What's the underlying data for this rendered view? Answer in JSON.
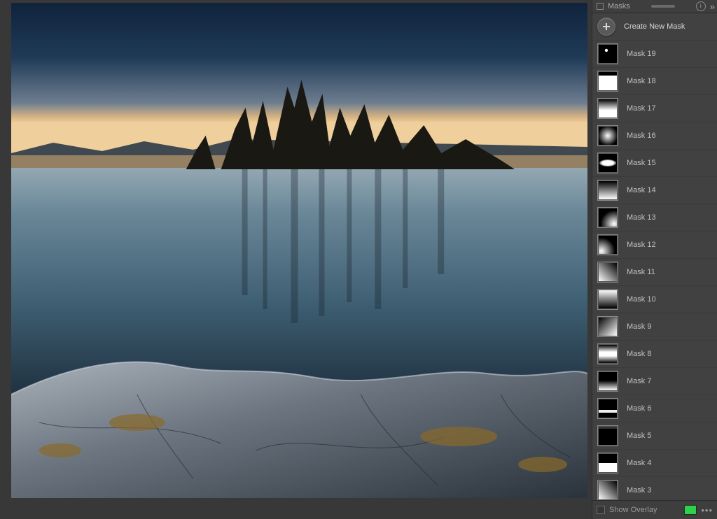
{
  "panel": {
    "title": "Masks",
    "create_label": "Create New Mask",
    "show_overlay_label": "Show Overlay",
    "overlay_color": "#2bd24a"
  },
  "masks": [
    {
      "label": "Mask 19",
      "thumb": "t19"
    },
    {
      "label": "Mask 18",
      "thumb": "t18"
    },
    {
      "label": "Mask 17",
      "thumb": "t17"
    },
    {
      "label": "Mask 16",
      "thumb": "t16"
    },
    {
      "label": "Mask 15",
      "thumb": "t15"
    },
    {
      "label": "Mask 14",
      "thumb": "t14"
    },
    {
      "label": "Mask 13",
      "thumb": "t13"
    },
    {
      "label": "Mask 12",
      "thumb": "t12"
    },
    {
      "label": "Mask 11",
      "thumb": "t11"
    },
    {
      "label": "Mask 10",
      "thumb": "t10"
    },
    {
      "label": "Mask 9",
      "thumb": "t9"
    },
    {
      "label": "Mask 8",
      "thumb": "t8"
    },
    {
      "label": "Mask 7",
      "thumb": "t7"
    },
    {
      "label": "Mask 6",
      "thumb": "t6"
    },
    {
      "label": "Mask 5",
      "thumb": "t5"
    },
    {
      "label": "Mask 4",
      "thumb": "t4"
    },
    {
      "label": "Mask 3",
      "thumb": "t3"
    }
  ]
}
